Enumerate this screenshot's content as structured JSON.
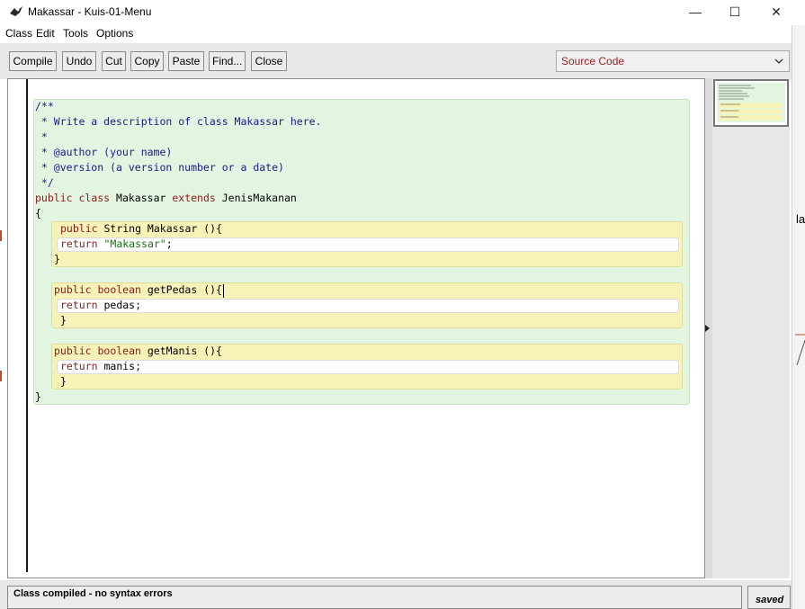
{
  "window": {
    "title": "Makassar - Kuis-01-Menu",
    "controls": {
      "minimize": "—",
      "maximize": "☐",
      "close": "✕"
    }
  },
  "menu": [
    "Class",
    "Edit",
    "Tools",
    "Options"
  ],
  "toolbar": {
    "buttons": [
      "Compile",
      "Undo",
      "Cut",
      "Copy",
      "Paste",
      "Find...",
      "Close"
    ],
    "view_select": "Source Code"
  },
  "code": {
    "lines": [
      "/**",
      " * Write a description of class Makassar here.",
      " *",
      " * @author (your name)",
      " * @version (a version number or a date)",
      " */",
      "public class Makassar extends JenisMakanan",
      "{",
      "public String Makassar (){",
      "return \"Makassar\";",
      "}",
      "public boolean getPedas (){",
      "return pedas;",
      "}",
      "public boolean getManis (){",
      "return manis;",
      "}",
      "}"
    ]
  },
  "status": {
    "message": "Class compiled - no syntax errors",
    "saved": "saved"
  },
  "background_window": {
    "label": "la"
  },
  "colors": {
    "class_scope": "#e2f5e1",
    "method_scope": "#f7f3b8",
    "keyword": "#8b1a1a",
    "comment": "#1a1a8c",
    "string": "#1a6e1a"
  }
}
